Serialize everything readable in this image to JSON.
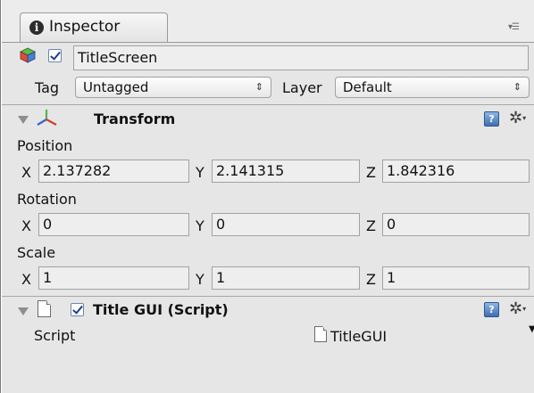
{
  "window": {
    "tab_label": "Inspector",
    "tab_icon": "info-icon",
    "menu_icon": "panel-menu-icon"
  },
  "game_object": {
    "icon": "gameobject-cube-icon",
    "active": true,
    "name": "TitleScreen",
    "tag_label": "Tag",
    "tag_value": "Untagged",
    "layer_label": "Layer",
    "layer_value": "Default"
  },
  "transform": {
    "expanded": true,
    "title": "Transform",
    "icon": "transform-axes-icon",
    "position_label": "Position",
    "position": {
      "x_label": "X",
      "x": "2.137282",
      "y_label": "Y",
      "y": "2.141315",
      "z_label": "Z",
      "z": "1.842316"
    },
    "rotation_label": "Rotation",
    "rotation": {
      "x_label": "X",
      "x": "0",
      "y_label": "Y",
      "y": "0",
      "z_label": "Z",
      "z": "0"
    },
    "scale_label": "Scale",
    "scale": {
      "x_label": "X",
      "x": "1",
      "y_label": "Y",
      "y": "1",
      "z_label": "Z",
      "z": "1"
    }
  },
  "script_component": {
    "expanded": true,
    "enabled": true,
    "title": "Title GUI (Script)",
    "script_label": "Script",
    "script_value": "TitleGUI"
  },
  "colors": {
    "panel_bg": "#e6e6e6",
    "field_bg": "#eeeeee",
    "help_blue": "#3d6fb0"
  }
}
